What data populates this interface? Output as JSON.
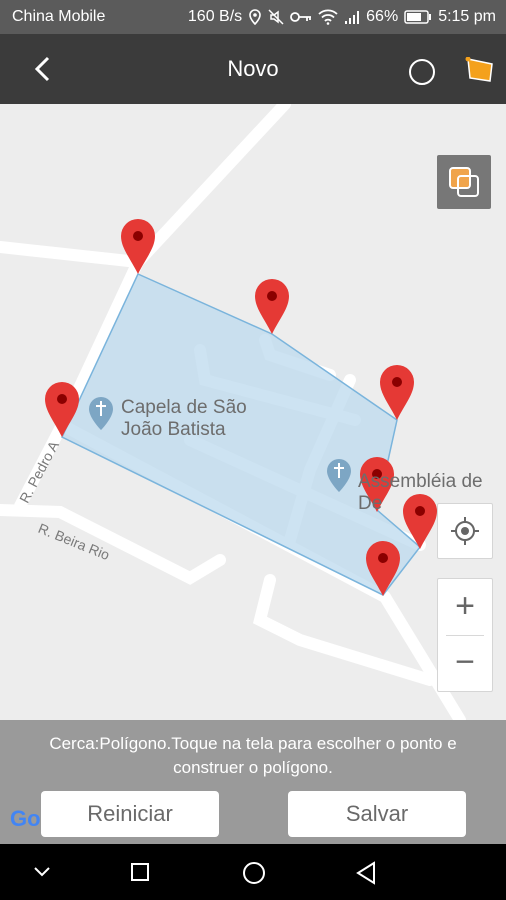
{
  "status_bar": {
    "carrier": "China Mobile",
    "speed": "160 B/s",
    "battery": "66%",
    "time": "5:15 pm"
  },
  "header": {
    "title": "Novo",
    "icons": [
      "back-arrow-icon",
      "circle-icon",
      "polygon-flag-icon"
    ]
  },
  "map": {
    "places": [
      {
        "line1": "Capela de São",
        "line2": "João Batista"
      },
      {
        "line1": "Assembléia de De"
      }
    ],
    "streets": [
      "R. Pedro A",
      "R. Beira Rio"
    ],
    "controls": {
      "zoom_in": "+",
      "zoom_out": "−"
    },
    "fence_color": "#bcd9ee",
    "marker_color": "#e53935"
  },
  "bottom": {
    "hint": "Cerca:Polígono.Toque na tela para escolher o ponto e construer o polígono.",
    "reset_label": "Reiniciar",
    "save_label": "Salvar",
    "google": "Go"
  },
  "nav": {
    "icons": [
      "chevron-down-icon",
      "square-icon",
      "circle-icon",
      "triangle-back-icon"
    ]
  }
}
